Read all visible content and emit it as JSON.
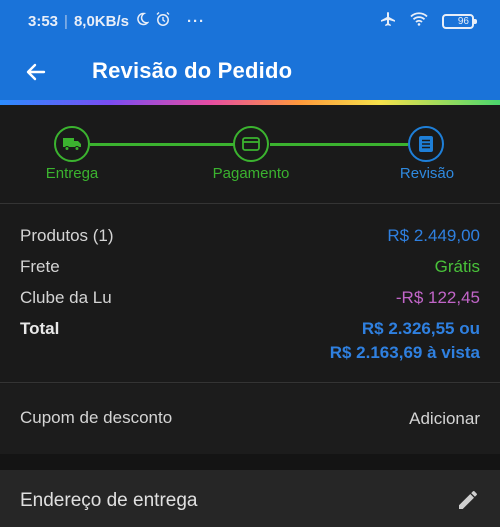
{
  "status_bar": {
    "time": "3:53",
    "separator": "|",
    "net_speed": "8,0KB/s",
    "dots": "···",
    "battery": "96"
  },
  "header": {
    "title": "Revisão do Pedido"
  },
  "stepper": {
    "steps": [
      {
        "label": "Entrega",
        "icon": "truck-icon",
        "state": "done"
      },
      {
        "label": "Pagamento",
        "icon": "card-icon",
        "state": "done"
      },
      {
        "label": "Revisão",
        "icon": "receipt-icon",
        "state": "active"
      }
    ]
  },
  "summary": {
    "products_label": "Produtos (1)",
    "products_value": "R$ 2.449,00",
    "shipping_label": "Frete",
    "shipping_value": "Grátis",
    "club_label": "Clube da Lu",
    "club_value": "-R$ 122,45",
    "total_label": "Total",
    "total_value_line1": "R$ 2.326,55 ou",
    "total_value_line2": "R$ 2.163,69 à vista"
  },
  "coupon": {
    "label": "Cupom de desconto",
    "action": "Adicionar"
  },
  "address": {
    "label": "Endereço de entrega"
  },
  "colors": {
    "brand_blue": "#1a73d9",
    "step_green": "#3bb32f",
    "price_blue": "#2f80e0",
    "discount_pink": "#c165c8"
  }
}
